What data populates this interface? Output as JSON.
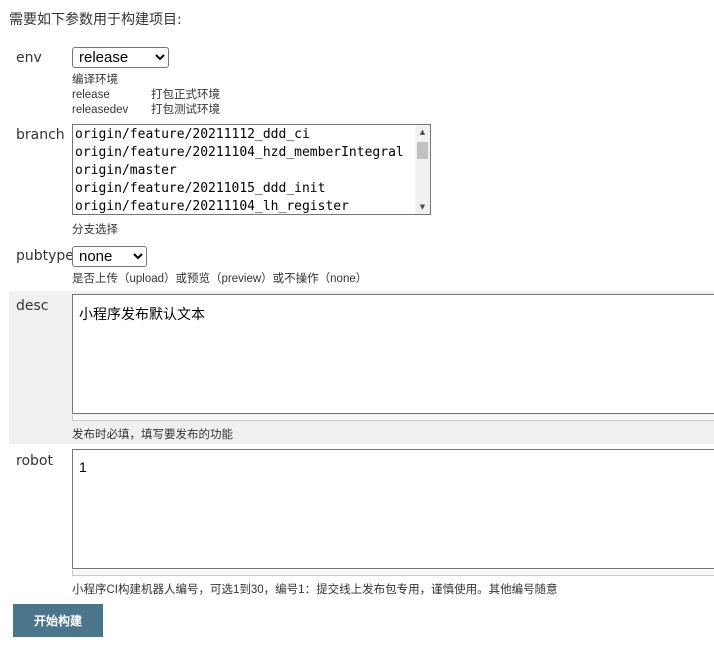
{
  "intro": "需要如下参数用于构建项目:",
  "env": {
    "label": "env",
    "selected": "release",
    "help": "编译环境",
    "options_help": [
      {
        "key": "release",
        "desc": "打包正式环境"
      },
      {
        "key": "releasedev",
        "desc": "打包测试环境"
      }
    ]
  },
  "branch": {
    "label": "branch",
    "options": [
      "origin/feature/20211112_ddd_ci",
      "origin/feature/20211104_hzd_memberIntegral",
      "origin/master",
      "origin/feature/20211015_ddd_init",
      "origin/feature/20211104_lh_register"
    ],
    "help": "分支选择"
  },
  "pubtype": {
    "label": "pubtype",
    "selected": "none",
    "help": "是否上传（upload）或预览（preview）或不操作（none）"
  },
  "desc": {
    "label": "desc",
    "value": "小程序发布默认文本",
    "help": "发布时必填，填写要发布的功能"
  },
  "robot": {
    "label": "robot",
    "value": "1",
    "help": "小程序CI构建机器人编号，可选1到30，编号1：提交线上发布包专用，谨慎使用。其他编号随意"
  },
  "build_button": "开始构建",
  "colors": {
    "button_bg": "#4b758b",
    "shaded_row": "#f0f0f0"
  }
}
